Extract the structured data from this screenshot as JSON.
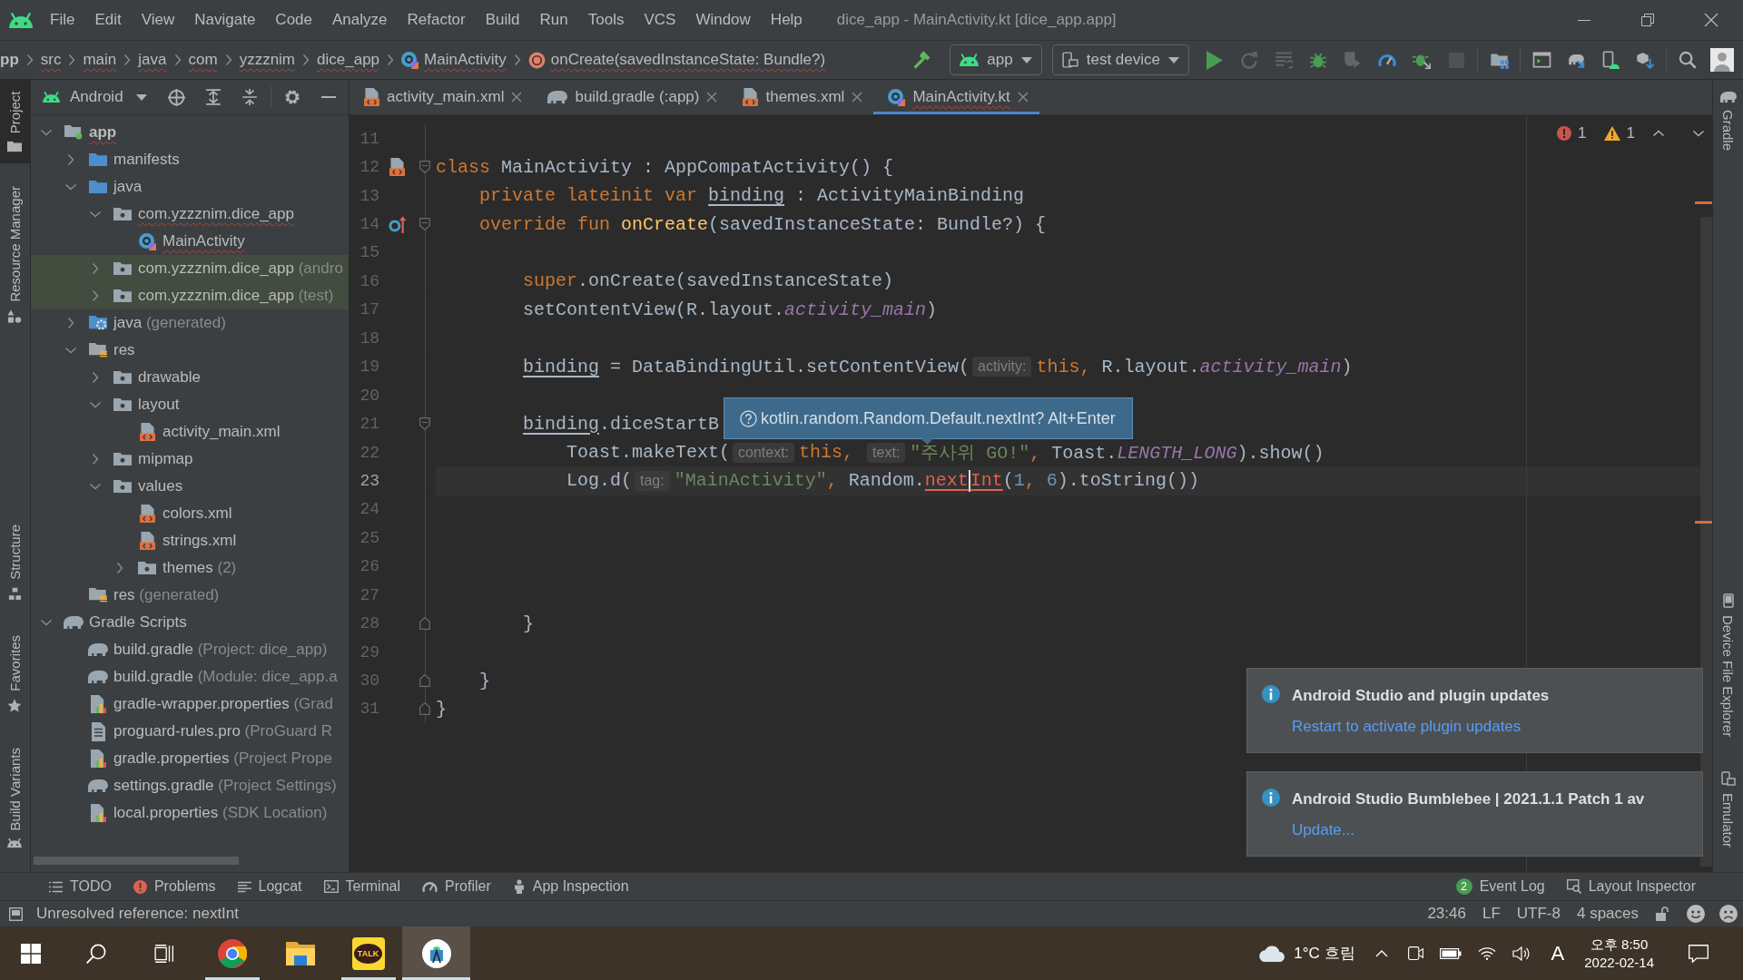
{
  "window": {
    "title": "dice_app - MainActivity.kt [dice_app.app]"
  },
  "menu": [
    "File",
    "Edit",
    "View",
    "Navigate",
    "Code",
    "Analyze",
    "Refactor",
    "Build",
    "Run",
    "Tools",
    "VCS",
    "Window",
    "Help"
  ],
  "breadcrumbs": [
    {
      "label": "pp",
      "kind": "module",
      "error": false
    },
    {
      "label": "src",
      "kind": "folder",
      "error": true
    },
    {
      "label": "main",
      "kind": "folder",
      "error": true
    },
    {
      "label": "java",
      "kind": "folder",
      "error": true
    },
    {
      "label": "com",
      "kind": "folder",
      "error": true
    },
    {
      "label": "yzzznim",
      "kind": "folder",
      "error": true
    },
    {
      "label": "dice_app",
      "kind": "folder",
      "error": true
    },
    {
      "label": "MainActivity",
      "kind": "class",
      "error": true
    },
    {
      "label": "onCreate(savedInstanceState: Bundle?)",
      "kind": "method",
      "error": true
    }
  ],
  "toolbar": {
    "run_config": "app",
    "device": "test device",
    "actions": [
      {
        "kind": "run",
        "disabled": false
      },
      {
        "kind": "apply-changes",
        "disabled": true
      },
      {
        "kind": "apply-code-changes",
        "disabled": true
      },
      {
        "kind": "debug",
        "disabled": false
      },
      {
        "kind": "coverage",
        "disabled": true
      },
      {
        "kind": "profile",
        "disabled": false
      },
      {
        "kind": "attach-debugger",
        "disabled": false
      },
      {
        "kind": "stop",
        "disabled": true
      }
    ]
  },
  "tool_windows": {
    "left": [
      {
        "label": "Project",
        "kind": "project",
        "selected": true
      },
      {
        "label": "Resource Manager",
        "kind": "resource-manager",
        "selected": false
      }
    ],
    "left_lower": [
      {
        "label": "Structure",
        "kind": "structure",
        "selected": false
      },
      {
        "label": "Favorites",
        "kind": "favorites",
        "selected": false
      },
      {
        "label": "Build Variants",
        "kind": "build-variants",
        "selected": false
      }
    ],
    "right": [
      {
        "label": "Gradle",
        "kind": "gradle",
        "selected": false
      }
    ],
    "right_lower": [
      {
        "label": "Device File Explorer",
        "kind": "device-file-explorer",
        "selected": false
      },
      {
        "label": "Emulator",
        "kind": "emulator",
        "selected": false
      }
    ]
  },
  "project": {
    "view": "Android",
    "tree": [
      {
        "label": "app",
        "kind": "module",
        "expanded": true,
        "highlighted": false,
        "error": true,
        "children": [
          {
            "label": "manifests",
            "kind": "source-folder",
            "expanded": false,
            "highlighted": false,
            "error": false
          },
          {
            "label": "java",
            "kind": "source-folder",
            "expanded": true,
            "highlighted": false,
            "error": false,
            "children": [
              {
                "label": "com.yzzznim.dice_app",
                "kind": "folder",
                "expanded": true,
                "highlighted": false,
                "error": true,
                "children": [
                  {
                    "label": "MainActivity",
                    "kind": "kotlin-class",
                    "highlighted": false,
                    "error": true
                  }
                ]
              },
              {
                "label": "com.yzzznim.dice_app",
                "hint": "(andro",
                "kind": "folder",
                "expanded": false,
                "highlighted": true,
                "error": false
              },
              {
                "label": "com.yzzznim.dice_app",
                "hint": "(test)",
                "kind": "folder",
                "expanded": false,
                "highlighted": true,
                "error": false
              }
            ]
          },
          {
            "label": "java",
            "hint": "(generated)",
            "kind": "generated-folder",
            "expanded": false,
            "highlighted": false,
            "error": false
          },
          {
            "label": "res",
            "kind": "resource-folder",
            "expanded": true,
            "highlighted": false,
            "error": false,
            "children": [
              {
                "label": "drawable",
                "kind": "folder",
                "expanded": false,
                "highlighted": false,
                "error": false
              },
              {
                "label": "layout",
                "kind": "folder",
                "expanded": true,
                "highlighted": false,
                "error": false,
                "children": [
                  {
                    "label": "activity_main.xml",
                    "kind": "xml",
                    "highlighted": false,
                    "error": false
                  }
                ]
              },
              {
                "label": "mipmap",
                "kind": "folder",
                "expanded": false,
                "highlighted": false,
                "error": false
              },
              {
                "label": "values",
                "kind": "folder",
                "expanded": true,
                "highlighted": false,
                "error": false,
                "children": [
                  {
                    "label": "colors.xml",
                    "kind": "xml",
                    "highlighted": false,
                    "error": false
                  },
                  {
                    "label": "strings.xml",
                    "kind": "xml",
                    "highlighted": false,
                    "error": false
                  },
                  {
                    "label": "themes",
                    "hint": "(2)",
                    "kind": "folder",
                    "expanded": false,
                    "highlighted": false,
                    "error": false
                  }
                ]
              }
            ]
          },
          {
            "label": "res",
            "hint": "(generated)",
            "kind": "resource-folder",
            "highlighted": false,
            "error": false
          }
        ]
      },
      {
        "label": "Gradle Scripts",
        "kind": "gradle",
        "expanded": true,
        "highlighted": false,
        "error": false,
        "children": [
          {
            "label": "build.gradle",
            "hint": "(Project: dice_app)",
            "kind": "gradle",
            "highlighted": false,
            "error": false
          },
          {
            "label": "build.gradle",
            "hint": "(Module: dice_app.a",
            "kind": "gradle",
            "highlighted": false,
            "error": false
          },
          {
            "label": "gradle-wrapper.properties",
            "hint": "(Grad",
            "kind": "properties",
            "highlighted": false,
            "error": false
          },
          {
            "label": "proguard-rules.pro",
            "hint": "(ProGuard R",
            "kind": "text-file",
            "highlighted": false,
            "error": false
          },
          {
            "label": "gradle.properties",
            "hint": "(Project Prope",
            "kind": "properties",
            "highlighted": false,
            "error": false
          },
          {
            "label": "settings.gradle",
            "hint": "(Project Settings)",
            "kind": "gradle",
            "highlighted": false,
            "error": false
          },
          {
            "label": "local.properties",
            "hint": "(SDK Location)",
            "kind": "properties",
            "highlighted": false,
            "error": false
          }
        ]
      }
    ]
  },
  "editor": {
    "tabs": [
      {
        "label": "activity_main.xml",
        "kind": "xml",
        "selected": false,
        "error": false
      },
      {
        "label": "build.gradle (:app)",
        "kind": "gradle",
        "selected": false,
        "error": false
      },
      {
        "label": "themes.xml",
        "kind": "xml",
        "selected": false,
        "error": false
      },
      {
        "label": "MainActivity.kt",
        "kind": "kotlin-class",
        "selected": true,
        "error": true
      }
    ],
    "problems": {
      "errors": "1",
      "warnings": "1"
    },
    "lines": [
      {
        "number": "11",
        "current": false
      },
      {
        "number": "12",
        "current": false,
        "gutter": {
          "kind": "layout-file"
        },
        "fold": {
          "kind": "start"
        },
        "tokens": [
          {
            "text": "class",
            "kind": "keyword"
          },
          {
            "text": " MainActivity : AppCompatActivity() {",
            "kind": "plain"
          }
        ],
        "children": [
          {
            "number": "13",
            "current": false,
            "tokens": [
              {
                "text": "private lateinit var ",
                "kind": "keyword"
              },
              {
                "text": "binding",
                "kind": "property"
              },
              {
                "text": " : ActivityMainBinding",
                "kind": "plain"
              }
            ]
          },
          {
            "number": "14",
            "current": false,
            "gutter": {
              "kind": "override"
            },
            "fold": {
              "kind": "start"
            },
            "tokens": [
              {
                "text": "override fun ",
                "kind": "keyword"
              },
              {
                "text": "onCreate",
                "kind": "function"
              },
              {
                "text": "(savedInstanceState: Bundle?) {",
                "kind": "plain"
              }
            ],
            "children": [
              {
                "number": "15",
                "current": false
              },
              {
                "number": "16",
                "current": false,
                "tokens": [
                  {
                    "text": "super",
                    "kind": "keyword"
                  },
                  {
                    "text": ".onCreate(savedInstanceState)",
                    "kind": "plain"
                  }
                ]
              },
              {
                "number": "17",
                "current": false,
                "tokens": [
                  {
                    "text": "setContentView(R.layout.",
                    "kind": "plain"
                  },
                  {
                    "text": "activity_main",
                    "kind": "static"
                  },
                  {
                    "text": ")",
                    "kind": "plain"
                  }
                ]
              },
              {
                "number": "18",
                "current": false
              },
              {
                "number": "19",
                "current": false,
                "tokens": [
                  {
                    "text": "binding",
                    "kind": "property"
                  },
                  {
                    "text": " = DataBindingUtil.setContentView(",
                    "kind": "plain"
                  },
                  {
                    "text": "activity:",
                    "kind": "hint"
                  },
                  {
                    "text": "this,",
                    "kind": "keyword"
                  },
                  {
                    "text": " R.layout.",
                    "kind": "plain"
                  },
                  {
                    "text": "activity_main",
                    "kind": "static"
                  },
                  {
                    "text": ")",
                    "kind": "plain"
                  }
                ]
              },
              {
                "number": "20",
                "current": false
              },
              {
                "number": "21",
                "current": false,
                "fold": {
                  "kind": "start"
                },
                "tokens": [
                  {
                    "text": "binding",
                    "kind": "property"
                  },
                  {
                    "text": ".diceStartB",
                    "kind": "plain"
                  }
                ],
                "children": [
                  {
                    "number": "22",
                    "current": false,
                    "tokens": [
                      {
                        "text": "Toast.makeText(",
                        "kind": "plain"
                      },
                      {
                        "text": "context:",
                        "kind": "hint"
                      },
                      {
                        "text": "this, ",
                        "kind": "keyword"
                      },
                      {
                        "text": "text:",
                        "kind": "hint"
                      },
                      {
                        "text": "\"주사위 GO!\"",
                        "kind": "string"
                      },
                      {
                        "text": ", ",
                        "kind": "keyword"
                      },
                      {
                        "text": "Toast.",
                        "kind": "plain"
                      },
                      {
                        "text": "LENGTH_LONG",
                        "kind": "static"
                      },
                      {
                        "text": ").show()",
                        "kind": "plain"
                      }
                    ]
                  },
                  {
                    "number": "23",
                    "current": true,
                    "tokens": [
                      {
                        "text": "Log.d(",
                        "kind": "plain"
                      },
                      {
                        "text": "tag:",
                        "kind": "hint"
                      },
                      {
                        "text": "\"MainActivity\"",
                        "kind": "string"
                      },
                      {
                        "text": ", ",
                        "kind": "keyword"
                      },
                      {
                        "text": "Random.",
                        "kind": "plain"
                      },
                      {
                        "text": "next",
                        "kind": "error"
                      },
                      {
                        "kind": "caret"
                      },
                      {
                        "text": "Int",
                        "kind": "error"
                      },
                      {
                        "text": "(",
                        "kind": "plain"
                      },
                      {
                        "text": "1",
                        "kind": "number"
                      },
                      {
                        "text": ", ",
                        "kind": "keyword"
                      },
                      {
                        "text": "6",
                        "kind": "number"
                      },
                      {
                        "text": ").toString())",
                        "kind": "plain"
                      }
                    ]
                  },
                  {
                    "number": "24",
                    "current": false
                  },
                  {
                    "number": "25",
                    "current": false
                  },
                  {
                    "number": "26",
                    "current": false
                  },
                  {
                    "number": "27",
                    "current": false
                  }
                ]
              },
              {
                "number": "28",
                "current": false,
                "fold": {
                  "kind": "end"
                },
                "tokens": [
                  {
                    "text": "}",
                    "kind": "plain"
                  }
                ]
              },
              {
                "number": "29",
                "current": false
              }
            ]
          },
          {
            "number": "30",
            "current": false,
            "fold": {
              "kind": "end"
            },
            "tokens": [
              {
                "text": "}",
                "kind": "plain"
              }
            ]
          }
        ]
      },
      {
        "number": "31",
        "current": false,
        "fold": {
          "kind": "end"
        },
        "tokens": [
          {
            "text": "}",
            "kind": "plain"
          }
        ]
      }
    ],
    "tooltip": "kotlin.random.Random.Default.nextInt? Alt+Enter"
  },
  "notifications": [
    {
      "title": "Android Studio and plugin updates",
      "link": "Restart to activate plugin updates"
    },
    {
      "title": "Android Studio Bumblebee | 2021.1.1 Patch 1 av",
      "link": "Update..."
    }
  ],
  "bottom_tools": {
    "left": [
      {
        "label": "TODO",
        "kind": "todo"
      },
      {
        "label": "Problems",
        "kind": "problems"
      },
      {
        "label": "Logcat",
        "kind": "logcat"
      },
      {
        "label": "Terminal",
        "kind": "terminal"
      },
      {
        "label": "Profiler",
        "kind": "profiler"
      },
      {
        "label": "App Inspection",
        "kind": "app-inspection"
      }
    ],
    "right": [
      {
        "label": "Event Log",
        "kind": "event-log",
        "badge": "2"
      },
      {
        "label": "Layout Inspector",
        "kind": "layout-inspector"
      }
    ]
  },
  "status_bar": {
    "message": "Unresolved reference: nextInt",
    "caret_position": "23:46",
    "line_separator": "LF",
    "encoding": "UTF-8",
    "indent": "4 spaces"
  },
  "taskbar": {
    "apps": [
      {
        "kind": "browser",
        "running": true,
        "active": false
      },
      {
        "kind": "file-explorer",
        "running": false,
        "active": false
      },
      {
        "kind": "messenger",
        "label": "TALK",
        "running": true,
        "active": false
      },
      {
        "kind": "ide",
        "running": true,
        "active": true
      }
    ],
    "weather": "1°C 흐림",
    "input_mode": "A",
    "time": "오후 8:50",
    "date": "2022-02-14"
  }
}
